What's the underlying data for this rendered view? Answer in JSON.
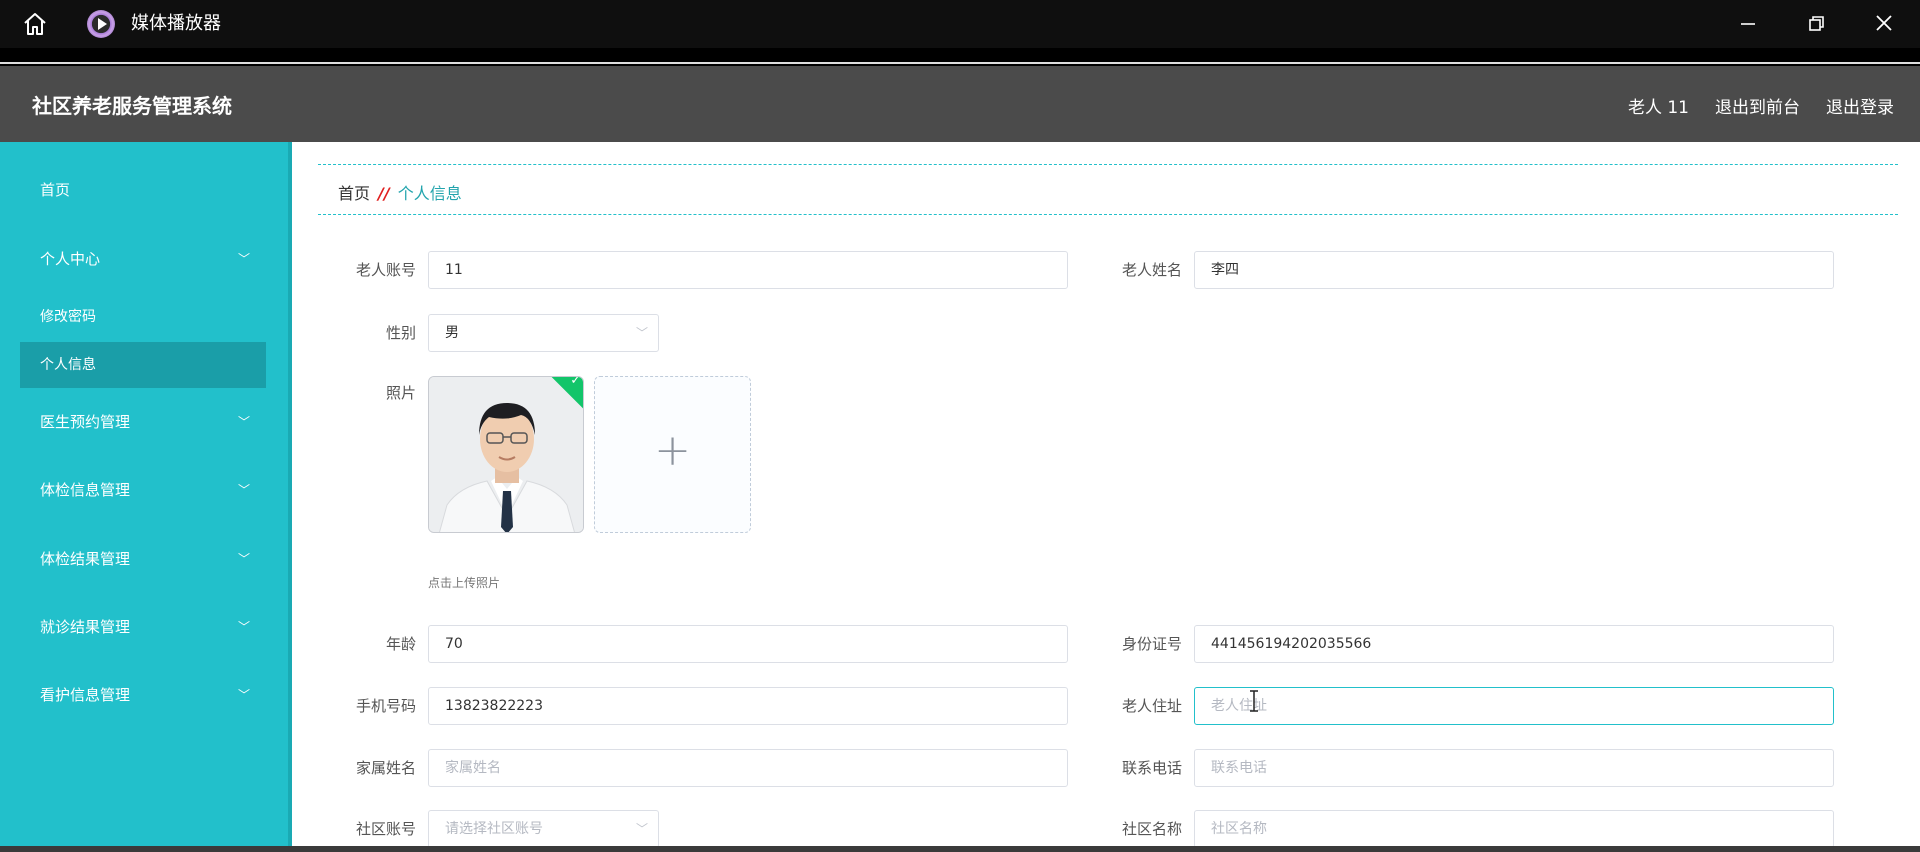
{
  "media_player": {
    "title": "媒体播放器",
    "icons": [
      "home-icon",
      "player-logo-icon",
      "minimize-icon",
      "restore-icon",
      "close-icon"
    ]
  },
  "header": {
    "brand": "社区养老服务管理系统",
    "user": "老人 11",
    "to_front": "退出到前台",
    "logout": "退出登录"
  },
  "sidebar": {
    "home": "首页",
    "personal_center": "个人中心",
    "change_password": "修改密码",
    "personal_info": "个人信息",
    "doctor_booking": "医生预约管理",
    "checkup_info": "体检信息管理",
    "checkup_result": "体检结果管理",
    "visit_result": "就诊结果管理",
    "care_info": "看护信息管理"
  },
  "breadcrumb": {
    "home": "首页",
    "separator": "//",
    "current": "个人信息"
  },
  "form": {
    "account_label": "老人账号",
    "account_value": "11",
    "name_label": "老人姓名",
    "name_value": "李四",
    "gender_label": "性别",
    "gender_value": "男",
    "photo_label": "照片",
    "upload_plus": "+",
    "upload_tip": "点击上传照片",
    "age_label": "年龄",
    "age_value": "70",
    "id_label": "身份证号",
    "id_value": "441456194202035566",
    "phone_label": "手机号码",
    "phone_value": "13823822223",
    "address_label": "老人住址",
    "address_placeholder": "老人住址",
    "family_name_label": "家属姓名",
    "family_name_placeholder": "家属姓名",
    "contact_label": "联系电话",
    "contact_placeholder": "联系电话",
    "community_account_label": "社区账号",
    "community_account_placeholder": "请选择社区账号",
    "community_name_label": "社区名称",
    "community_name_placeholder": "社区名称"
  },
  "colors": {
    "sidebar": "#22c0cb",
    "header": "#4b4b4b",
    "accent": "#22c0cb"
  }
}
